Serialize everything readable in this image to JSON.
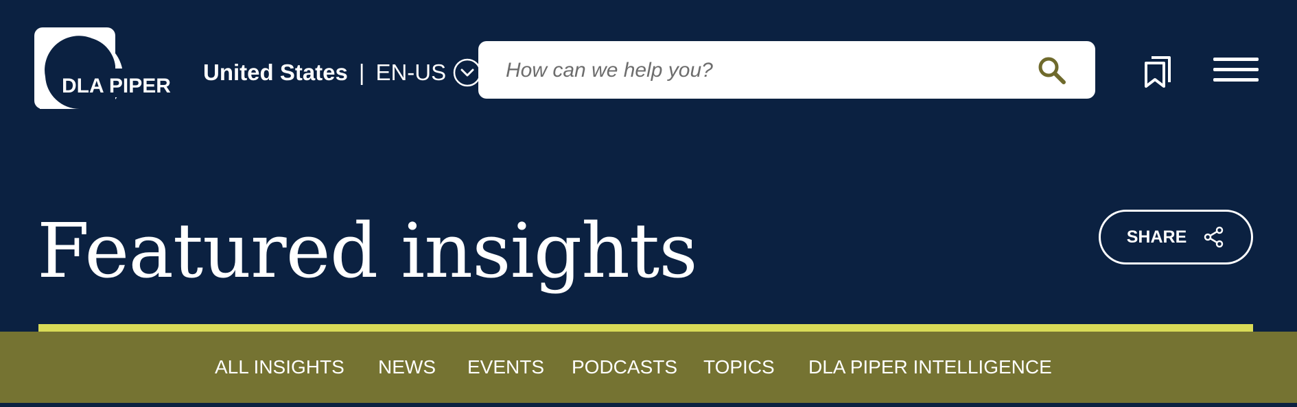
{
  "header": {
    "logo_text": "DLA PIPER",
    "region": {
      "country": "United States",
      "separator": "|",
      "language": "EN-US"
    },
    "search": {
      "placeholder": "How can we help you?",
      "value": ""
    },
    "icons": {
      "search": "search-icon",
      "bookmark": "bookmark-icon",
      "menu": "hamburger-menu-icon",
      "language_dropdown": "chevron-down-icon"
    }
  },
  "main": {
    "title": "Featured insights",
    "share_label": "SHARE",
    "share_icon": "share-icon"
  },
  "nav": {
    "items": [
      {
        "label": "ALL INSIGHTS"
      },
      {
        "label": "NEWS"
      },
      {
        "label": "EVENTS"
      },
      {
        "label": "PODCASTS"
      },
      {
        "label": "TOPICS"
      },
      {
        "label": "DLA PIPER INTELLIGENCE"
      }
    ]
  },
  "colors": {
    "background": "#0b2141",
    "accent": "#d9db57",
    "nav_background": "#757332",
    "search_icon": "#6f6a2c"
  }
}
